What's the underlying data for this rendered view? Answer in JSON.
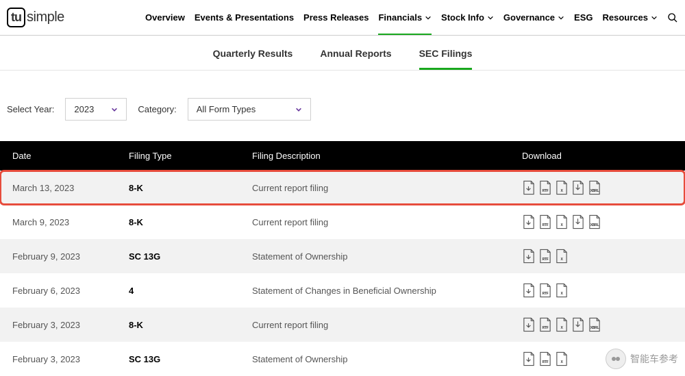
{
  "logo": {
    "box": "tu",
    "text": "simple"
  },
  "nav": {
    "items": [
      {
        "label": "Overview",
        "dropdown": false
      },
      {
        "label": "Events & Presentations",
        "dropdown": false
      },
      {
        "label": "Press Releases",
        "dropdown": false
      },
      {
        "label": "Financials",
        "dropdown": true,
        "active": true
      },
      {
        "label": "Stock Info",
        "dropdown": true
      },
      {
        "label": "Governance",
        "dropdown": true
      },
      {
        "label": "ESG",
        "dropdown": false
      },
      {
        "label": "Resources",
        "dropdown": true
      }
    ]
  },
  "sub_tabs": {
    "items": [
      {
        "label": "Quarterly Results",
        "active": false
      },
      {
        "label": "Annual Reports",
        "active": false
      },
      {
        "label": "SEC Filings",
        "active": true
      }
    ]
  },
  "filters": {
    "year_label": "Select Year:",
    "year_value": "2023",
    "category_label": "Category:",
    "category_value": "All Form Types"
  },
  "table": {
    "headers": {
      "date": "Date",
      "type": "Filing Type",
      "desc": "Filing Description",
      "download": "Download"
    },
    "rows": [
      {
        "date": "March 13, 2023",
        "type": "8-K",
        "desc": "Current report filing",
        "downloads": [
          "PDF",
          "RTF",
          "X",
          "ZIP",
          "XBRL"
        ],
        "highlighted": true
      },
      {
        "date": "March 9, 2023",
        "type": "8-K",
        "desc": "Current report filing",
        "downloads": [
          "PDF",
          "RTF",
          "X",
          "ZIP",
          "XBRL"
        ]
      },
      {
        "date": "February 9, 2023",
        "type": "SC 13G",
        "desc": "Statement of Ownership",
        "downloads": [
          "PDF",
          "RTF",
          "X"
        ]
      },
      {
        "date": "February 6, 2023",
        "type": "4",
        "desc": "Statement of Changes in Beneficial Ownership",
        "downloads": [
          "PDF",
          "RTF",
          "X"
        ]
      },
      {
        "date": "February 3, 2023",
        "type": "8-K",
        "desc": "Current report filing",
        "downloads": [
          "PDF",
          "RTF",
          "X",
          "ZIP",
          "XBRL"
        ]
      },
      {
        "date": "February 3, 2023",
        "type": "SC 13G",
        "desc": "Statement of Ownership",
        "downloads": [
          "PDF",
          "RTF",
          "X"
        ]
      }
    ]
  },
  "watermark": {
    "text": "智能车参考"
  }
}
